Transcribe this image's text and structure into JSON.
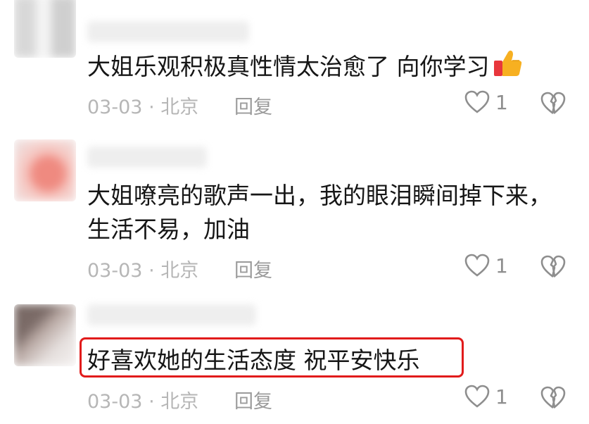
{
  "comments": [
    {
      "text_lines": [
        "大姐乐观积极真性情太治愈了  向你学习"
      ],
      "emoji": "thumbs-up",
      "date": "03-03",
      "separator": "·",
      "location": "北京",
      "reply_label": "回复",
      "likes": "1"
    },
    {
      "text_lines": [
        "大姐嘹亮的歌声一出，我的眼泪瞬间掉下来，",
        "生活不易，加油"
      ],
      "date": "03-03",
      "separator": "·",
      "location": "北京",
      "reply_label": "回复",
      "likes": "1"
    },
    {
      "text_lines": [
        "好喜欢她的生活态度  祝平安快乐"
      ],
      "date": "03-03",
      "separator": "·",
      "location": "北京",
      "reply_label": "回复",
      "likes": "1",
      "highlighted": true
    }
  ],
  "colors": {
    "highlight_border": "#e11b1b",
    "meta_text": "#b6b6b6",
    "icon_gray": "#8e8e8e"
  }
}
